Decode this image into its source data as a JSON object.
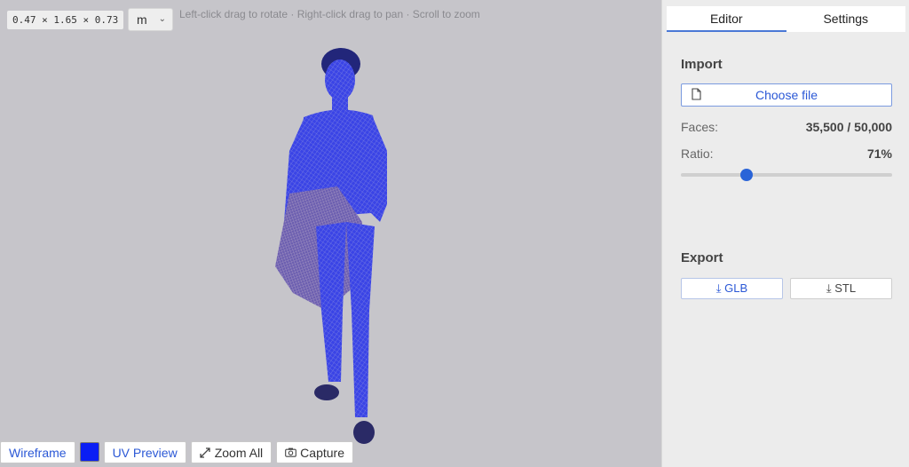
{
  "viewport": {
    "dimensions": "0.47 × 1.65 × 0.73",
    "unit": "m",
    "hint": "Left-click drag to rotate · Right-click drag to pan · Scroll to zoom"
  },
  "bottom_bar": {
    "wireframe": "Wireframe",
    "color_swatch": "#0a1ef4",
    "uv_preview": "UV Preview",
    "zoom_all": "Zoom All",
    "capture": "Capture"
  },
  "panel": {
    "tabs": [
      "Editor",
      "Settings"
    ],
    "active_tab": "Editor",
    "import": {
      "title": "Import",
      "choose_file": "Choose file",
      "faces_label": "Faces:",
      "faces_value": "35,500 / 50,000",
      "ratio_label": "Ratio:",
      "ratio_value": "71%",
      "ratio_fraction": 0.71
    },
    "export": {
      "title": "Export",
      "glb": "GLB",
      "stl": "STL"
    }
  },
  "colors": {
    "accent": "#2a64d8",
    "mesh": "#2a38e8"
  }
}
